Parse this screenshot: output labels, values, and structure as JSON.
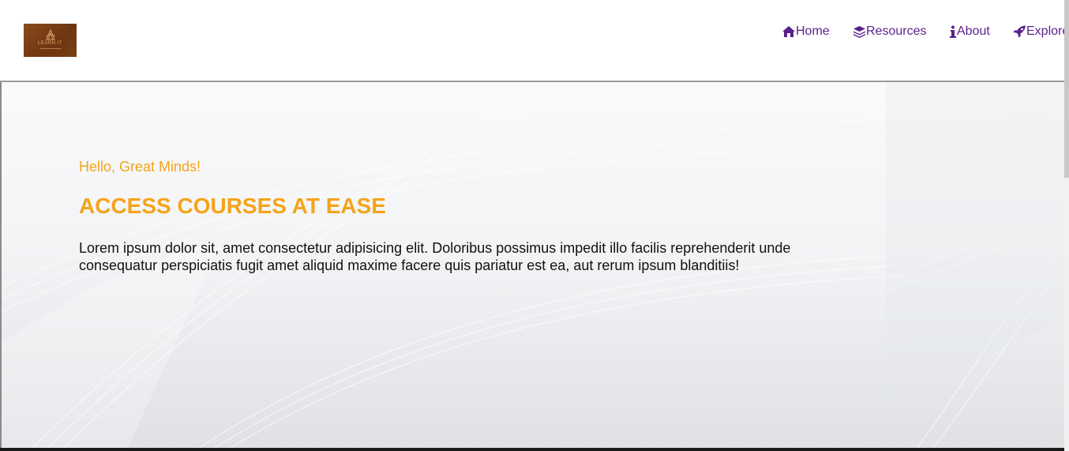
{
  "header": {
    "logo": {
      "text": "LEARN IT",
      "colors": {
        "bg": "#7a4016",
        "text": "#d9a86a"
      }
    },
    "nav": [
      {
        "label": "Home",
        "icon": "home-icon"
      },
      {
        "label": "Resources",
        "icon": "layers-icon"
      },
      {
        "label": "About",
        "icon": "info-icon"
      },
      {
        "label": "Explore",
        "icon": "rocket-icon"
      }
    ]
  },
  "hero": {
    "greeting": "Hello, Great Minds!",
    "headline": "ACCESS COURSES AT EASE",
    "description": "Lorem ipsum dolor sit, amet consectetur adipisicing elit. Doloribus possimus impedit illo facilis reprehenderit unde consequatur perspiciatis fugit amet aliquid maxime facere quis pariatur est ea, aut rerum ipsum blanditiis!"
  },
  "colors": {
    "accent": "#f5a31a",
    "nav": "#5a1f8c",
    "text": "#111111"
  }
}
